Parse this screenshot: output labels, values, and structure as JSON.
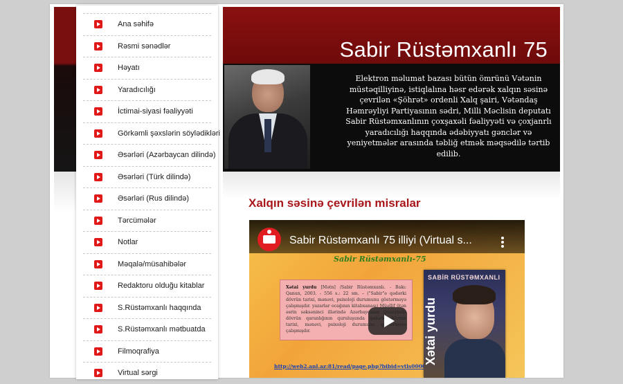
{
  "header": {
    "title": "Sabir Rüstəmxanlı 75",
    "description": "Elektron məlumat bazası bütün ömrünü Vətənin müstəqilliyinə, istiqlalına həsr edərək xalqın səsinə çevrilən «Şöhrət» ordenli Xalq şairi, Vətəndaş Həmrəyliyi Partiyasının sədri, Milli Məclisin deputatı Sabir Rüstəmxanlının çoxşaxəli fəaliyyəti və çoxjanrlı yaradıcılığı haqqında ədəbiyyatı gənclər və yeniyetmələr arasında təbliğ etmək məqsədilə tərtib edilib."
  },
  "sidebar": {
    "items": [
      {
        "label": "Ana səhifə"
      },
      {
        "label": "Rəsmi sənədlər"
      },
      {
        "label": "Həyatı"
      },
      {
        "label": "Yaradıcılığı"
      },
      {
        "label": "İctimai-siyasi fəaliyyəti"
      },
      {
        "label": "Görkəmli şəxslərin söylədikləri"
      },
      {
        "label": "Əsərləri (Azərbaycan dilində)"
      },
      {
        "label": "Əsərləri (Türk dilində)"
      },
      {
        "label": "Əsərləri (Rus dilində)"
      },
      {
        "label": "Tərcümələr"
      },
      {
        "label": "Notlar"
      },
      {
        "label": "Məqalə/müsahibələr"
      },
      {
        "label": "Redaktoru olduğu kitablar"
      },
      {
        "label": "S.Rüstəmxanlı haqqında"
      },
      {
        "label": "S.Rüstəmxanlı mətbuatda"
      },
      {
        "label": "Filmoqrafiya"
      },
      {
        "label": "Virtual sərgi"
      }
    ],
    "icon": "red-play-bullet-icon"
  },
  "main": {
    "section_title": "Xalqın səsinə çevrilən misralar",
    "video": {
      "title": "Sabir Rüstəmxanlı 75 illiyi (Virtual s...",
      "slide_heading": "Sabir Rüstəmxanlı-75",
      "slide_entry_title": "Xətai yurdu",
      "slide_entry_text": "[Mətn] /Sabir Rüstəmxanlı. - Bakı: Qanun, 2003. - 556 s.: 22 sm. – (\"Sabir\"ə qədərki dövrün tarixi, mənəvi, psixoloji durumunu göstərməyə çalışmışdır. yazarlar ocağının kitabxanası) Müəllif ötən əsrin səksəninci illərində Azərbaycanın Quzeyində dövrün qaranlığının quruluşunda qədərki dövrün tarixi, mənəvi, psixoloji durumunu göstərməyə çalışmışdır.",
      "slide_link": "http://web2.anl.az:81/read/page.php?bibid=vtls000001778",
      "cover_author": "SABİR RÜSTƏMXANLI",
      "cover_title": "Xətai yurdu",
      "play_icon": "play-icon",
      "menu_icon": "more-vertical-icon",
      "colors": {
        "play_bg": "#1e1e1e",
        "logo": "#e11d22",
        "slide_bg": "#f6c24a"
      }
    }
  },
  "colors": {
    "accent": "#a8161a",
    "banner_red": "#7a0f0f",
    "banner_dark": "#0c0c0c"
  }
}
